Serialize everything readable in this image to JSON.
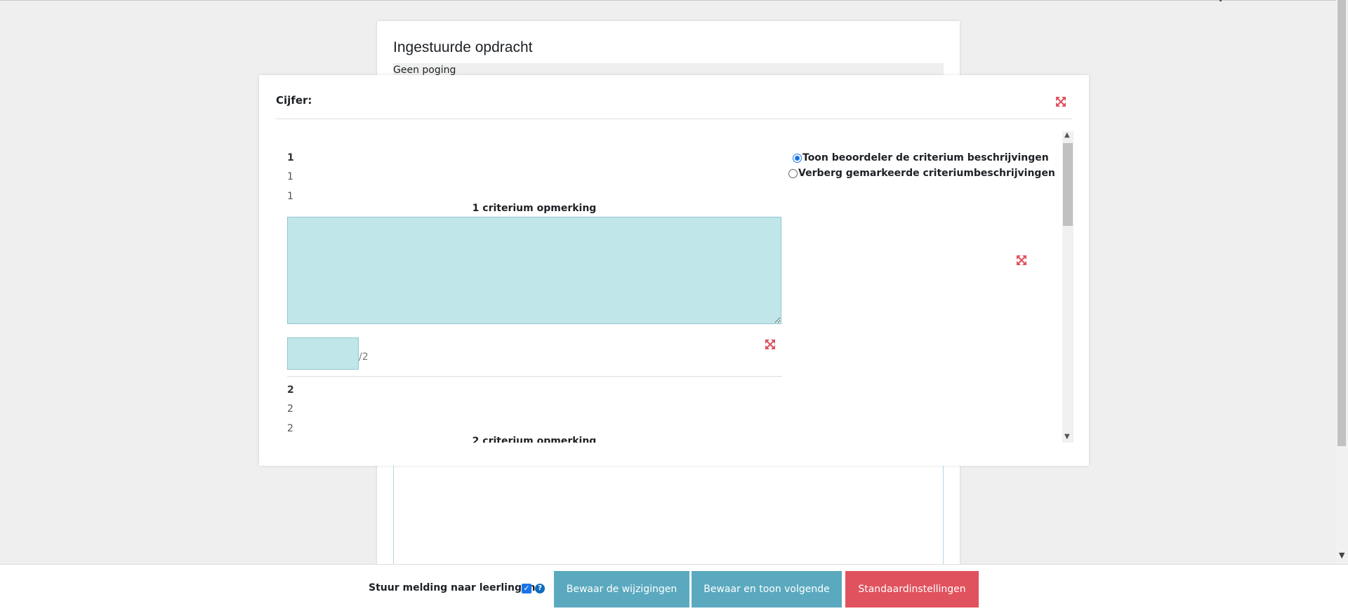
{
  "card": {
    "title": "Ingestuurde opdracht",
    "status": "Geen poging"
  },
  "modal": {
    "label": "Cijfer:",
    "criteria": [
      {
        "num_bold": "1",
        "num_a": "1",
        "num_b": "1",
        "heading": "1 criterium opmerking",
        "remark": "",
        "score": "",
        "max": "/2"
      },
      {
        "num_bold": "2",
        "num_a": "2",
        "num_b": "2",
        "heading": "2 criterium opmerking"
      }
    ],
    "options": {
      "show": "Toon beoordeler de criterium beschrijvingen",
      "hide": "Verberg gemarkeerde criteriumbeschrijvingen",
      "selected": "show"
    }
  },
  "footer": {
    "notify_label": "Stuur melding naar leerlingen",
    "notify_checked": true,
    "save_label": "Bewaar de wijzigingen",
    "save_next_label": "Bewaar en toon volgende",
    "defaults_label": "Standaardinstellingen"
  },
  "colors": {
    "accent": "#5aa9bf",
    "danger": "#e0525d",
    "input_bg": "#c1e6e9",
    "icon_red": "#e0525d"
  },
  "icons": {
    "expand": "expand-icon",
    "help": "help-icon",
    "checkbox": "checkbox-icon"
  }
}
